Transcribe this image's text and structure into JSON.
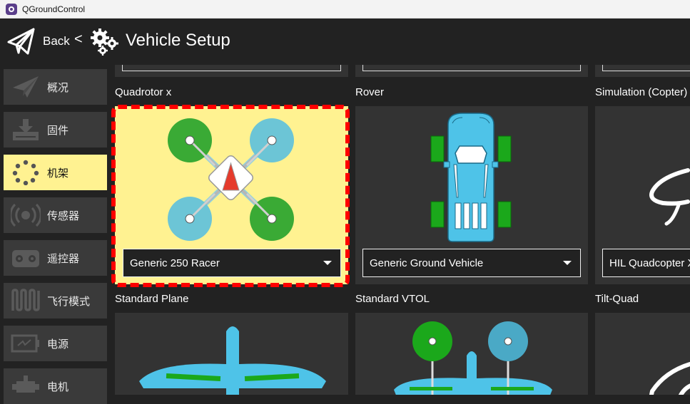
{
  "window": {
    "title": "QGroundControl"
  },
  "header": {
    "back_label": "Back",
    "separator": "<",
    "page_title": "Vehicle Setup"
  },
  "sidebar": {
    "items": [
      {
        "label": "概况",
        "icon": "paper-plane-icon",
        "active": false
      },
      {
        "label": "固件",
        "icon": "firmware-download-icon",
        "active": false
      },
      {
        "label": "机架",
        "icon": "airframe-dots-icon",
        "active": true
      },
      {
        "label": "传感器",
        "icon": "sensors-icon",
        "active": false
      },
      {
        "label": "遥控器",
        "icon": "radio-controller-icon",
        "active": false
      },
      {
        "label": "飞行模式",
        "icon": "flight-modes-wave-icon",
        "active": false
      },
      {
        "label": "电源",
        "icon": "battery-icon",
        "active": false
      },
      {
        "label": "电机",
        "icon": "motor-icon",
        "active": false
      }
    ]
  },
  "frames": [
    {
      "name": "Quadrotor x",
      "selected_value": "Generic 250 Racer",
      "selected": true
    },
    {
      "name": "Rover",
      "selected_value": "Generic Ground Vehicle",
      "selected": false
    },
    {
      "name": "Simulation (Copter)",
      "selected_value": "HIL Quadcopter X",
      "selected": false
    },
    {
      "name": "Standard Plane",
      "selected": false
    },
    {
      "name": "Standard VTOL",
      "selected": false
    },
    {
      "name": "Tilt-Quad",
      "selected": false
    }
  ],
  "colors": {
    "highlight": "#fff291",
    "card": "#333333",
    "background": "#222222",
    "quad_green": "#3aaa35",
    "quad_blue": "#6cc5d6",
    "vehicle_blue": "#4ec3e8",
    "wheel_green": "#1ba81b",
    "selection_outline": "#ff0000"
  }
}
